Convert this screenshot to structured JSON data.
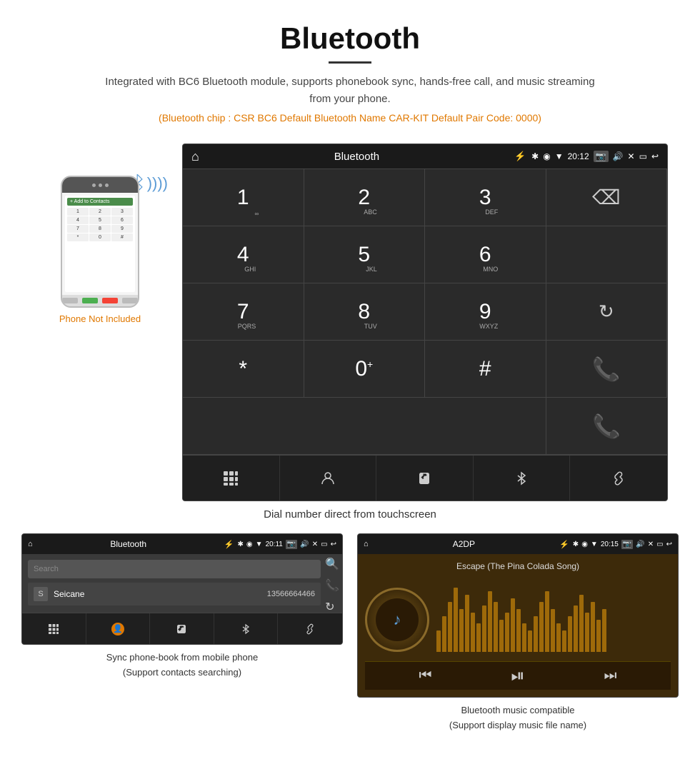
{
  "page": {
    "title": "Bluetooth",
    "subtitle": "Integrated with BC6 Bluetooth module, supports phonebook sync, hands-free call, and music streaming from your phone.",
    "specs": "(Bluetooth chip : CSR BC6    Default Bluetooth Name CAR-KIT    Default Pair Code: 0000)",
    "dial_caption": "Dial number direct from touchscreen",
    "phone_not_included": "Phone Not Included",
    "bottom_left_caption": "Sync phone-book from mobile phone\n(Support contacts searching)",
    "bottom_right_caption": "Bluetooth music compatible\n(Support display music file name)"
  },
  "dial_screen": {
    "status": {
      "home_icon": "⌂",
      "title": "Bluetooth",
      "usb_icon": "⚡",
      "bt_icon": "✱",
      "location_icon": "◉",
      "signal_icon": "▾",
      "time": "20:12",
      "camera_icon": "📷",
      "volume_icon": "🔊",
      "close_icon": "✕",
      "window_icon": "▭",
      "back_icon": "↩"
    },
    "keys": [
      {
        "main": "1",
        "sub": ""
      },
      {
        "main": "2",
        "sub": "ABC"
      },
      {
        "main": "3",
        "sub": "DEF"
      },
      {
        "main": "",
        "sub": ""
      },
      {
        "main": "4",
        "sub": "GHI"
      },
      {
        "main": "5",
        "sub": "JKL"
      },
      {
        "main": "6",
        "sub": "MNO"
      },
      {
        "main": "",
        "sub": ""
      },
      {
        "main": "7",
        "sub": "PQRS"
      },
      {
        "main": "8",
        "sub": "TUV"
      },
      {
        "main": "9",
        "sub": "WXYZ"
      },
      {
        "main": "reload",
        "sub": ""
      },
      {
        "main": "*",
        "sub": ""
      },
      {
        "main": "0+",
        "sub": ""
      },
      {
        "main": "#",
        "sub": ""
      },
      {
        "main": "call_green",
        "sub": ""
      },
      {
        "main": "call_red",
        "sub": ""
      }
    ],
    "bottom_icons": [
      "⊞",
      "👤",
      "📞",
      "✱",
      "🔗"
    ]
  },
  "phonebook_screen": {
    "status": {
      "home_icon": "⌂",
      "title": "Bluetooth",
      "usb_icon": "⚡",
      "bt_icon": "✱",
      "location_icon": "◉",
      "signal_icon": "▾",
      "time": "20:11",
      "camera_icon": "📷",
      "volume_icon": "🔊",
      "close_icon": "✕",
      "window_icon": "▭",
      "back_icon": "↩"
    },
    "search_placeholder": "Search",
    "contacts": [
      {
        "letter": "S",
        "name": "Seicane",
        "number": "13566664466"
      }
    ],
    "side_icons": [
      "🔍",
      "📞",
      "↻"
    ],
    "bottom_icons": [
      "⊞",
      "👤",
      "📞",
      "✱",
      "🔗"
    ]
  },
  "music_screen": {
    "status": {
      "home_icon": "⌂",
      "title": "A2DP",
      "usb_icon": "⚡",
      "bt_icon": "✱",
      "location_icon": "◉",
      "signal_icon": "▾",
      "time": "20:15",
      "camera_icon": "📷",
      "volume_icon": "🔊",
      "close_icon": "✕",
      "window_icon": "▭",
      "back_icon": "↩"
    },
    "song_title": "Escape (The Pina Colada Song)",
    "eq_bars": [
      30,
      50,
      70,
      90,
      60,
      80,
      55,
      40,
      65,
      85,
      70,
      45,
      55,
      75,
      60,
      40,
      30,
      50,
      70,
      85,
      60,
      40,
      30,
      50,
      65,
      80,
      55,
      70,
      45,
      60
    ],
    "controls": {
      "prev": "⏮",
      "play_pause": "⏯",
      "next": "⏭"
    }
  }
}
